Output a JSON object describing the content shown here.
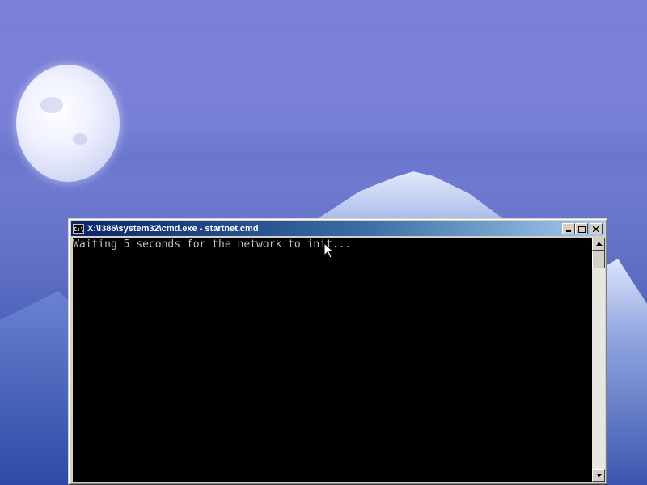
{
  "window": {
    "title": "X:\\i386\\system32\\cmd.exe - startnet.cmd",
    "icon_text": "C:\\",
    "title_buttons": [
      "minimize",
      "maximize",
      "close"
    ]
  },
  "console": {
    "lines": [
      "Waiting 5 seconds for the network to init..."
    ],
    "text_color": "#c0c0c0",
    "background_color": "#000000"
  },
  "desktop": {
    "wallpaper": "moon over snowy mountain peak at dusk",
    "sky_color": "#7b7fd6"
  },
  "colors": {
    "titlebar_start": "#0a246a",
    "titlebar_end": "#a6caf0",
    "chrome": "#d4d0c8"
  }
}
